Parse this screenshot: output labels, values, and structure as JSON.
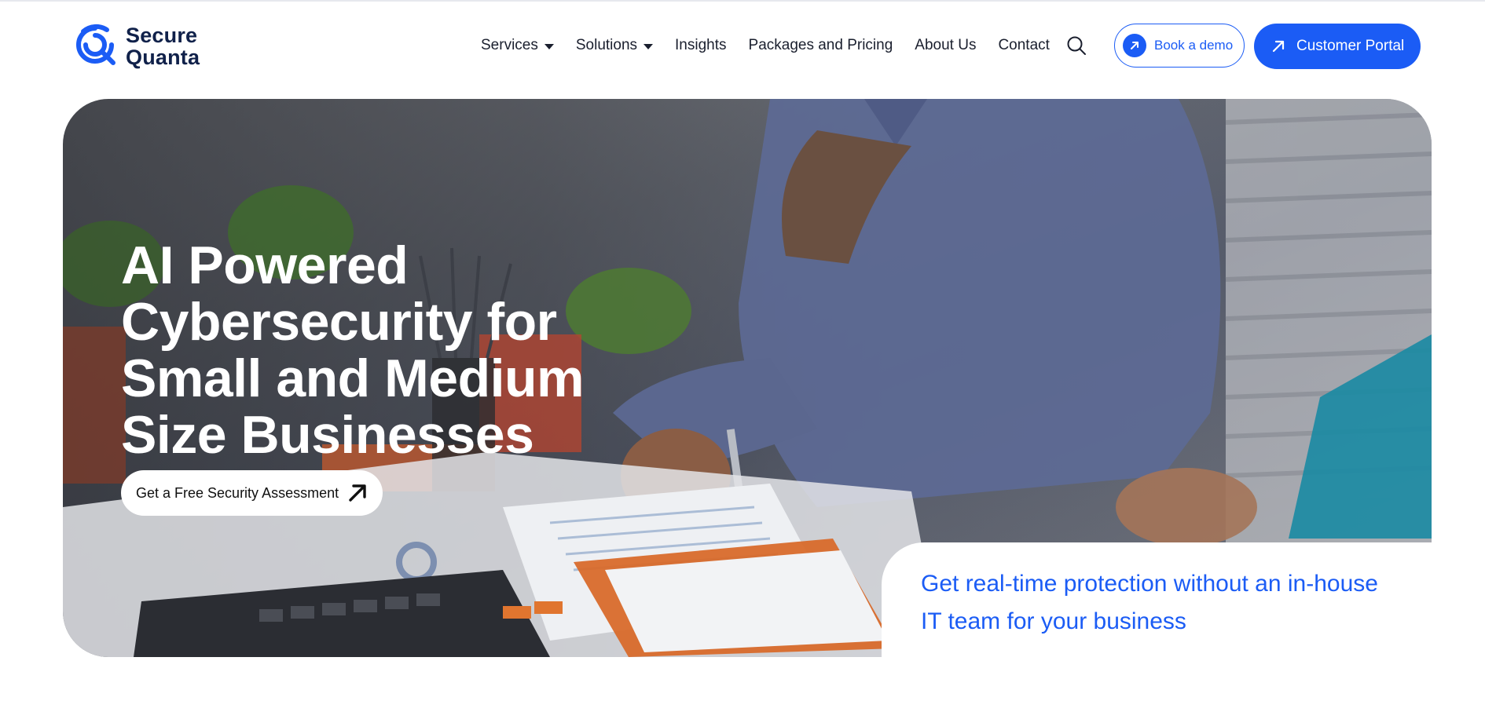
{
  "brand": {
    "line1": "Secure",
    "line2": "Quanta",
    "logo_icon": "secure-quanta-logo-icon",
    "accent_color": "#1b5cf5"
  },
  "nav": {
    "items": [
      {
        "label": "Services",
        "has_dropdown": true
      },
      {
        "label": "Solutions",
        "has_dropdown": true
      },
      {
        "label": "Insights",
        "has_dropdown": false
      },
      {
        "label": "Packages and Pricing",
        "has_dropdown": false
      },
      {
        "label": "About Us",
        "has_dropdown": false
      },
      {
        "label": "Contact",
        "has_dropdown": false
      }
    ],
    "search_icon": "search-icon"
  },
  "header_buttons": {
    "demo_label": "Book a demo",
    "portal_label": "Customer Portal"
  },
  "hero": {
    "title_lines": [
      "AI Powered",
      "Cybersecurity for",
      "Small and Medium",
      "Size Businesses"
    ],
    "cta_label": "Get a Free Security Assessment",
    "tagline_lines": [
      "Get real-time protection without an in-house",
      "IT team for your business"
    ]
  }
}
